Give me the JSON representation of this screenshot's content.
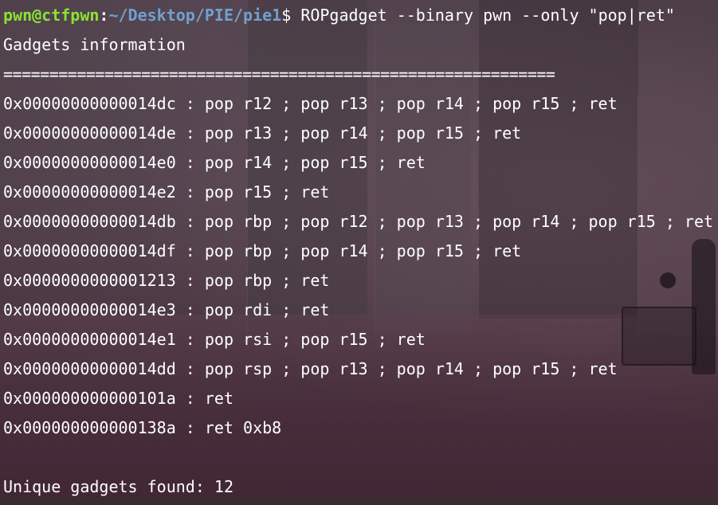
{
  "prompt": {
    "user": "pwn@ctfpwn",
    "separator": ":",
    "path": "~/Desktop/PIE/pie1",
    "symbol": "$",
    "command": "ROPgadget --binary pwn --only \"pop|ret\""
  },
  "output": {
    "header": "Gadgets information",
    "separator_line": "============================================================",
    "gadgets": [
      "0x00000000000014dc : pop r12 ; pop r13 ; pop r14 ; pop r15 ; ret",
      "0x00000000000014de : pop r13 ; pop r14 ; pop r15 ; ret",
      "0x00000000000014e0 : pop r14 ; pop r15 ; ret",
      "0x00000000000014e2 : pop r15 ; ret",
      "0x00000000000014db : pop rbp ; pop r12 ; pop r13 ; pop r14 ; pop r15 ; ret",
      "0x00000000000014df : pop rbp ; pop r14 ; pop r15 ; ret",
      "0x0000000000001213 : pop rbp ; ret",
      "0x00000000000014e3 : pop rdi ; ret",
      "0x00000000000014e1 : pop rsi ; pop r15 ; ret",
      "0x00000000000014dd : pop rsp ; pop r13 ; pop r14 ; pop r15 ; ret",
      "0x000000000000101a : ret",
      "0x000000000000138a : ret 0xb8"
    ],
    "summary": "Unique gadgets found: 12"
  },
  "colors": {
    "user": "#8ae234",
    "path": "#729fcf",
    "text": "#ffffff"
  }
}
